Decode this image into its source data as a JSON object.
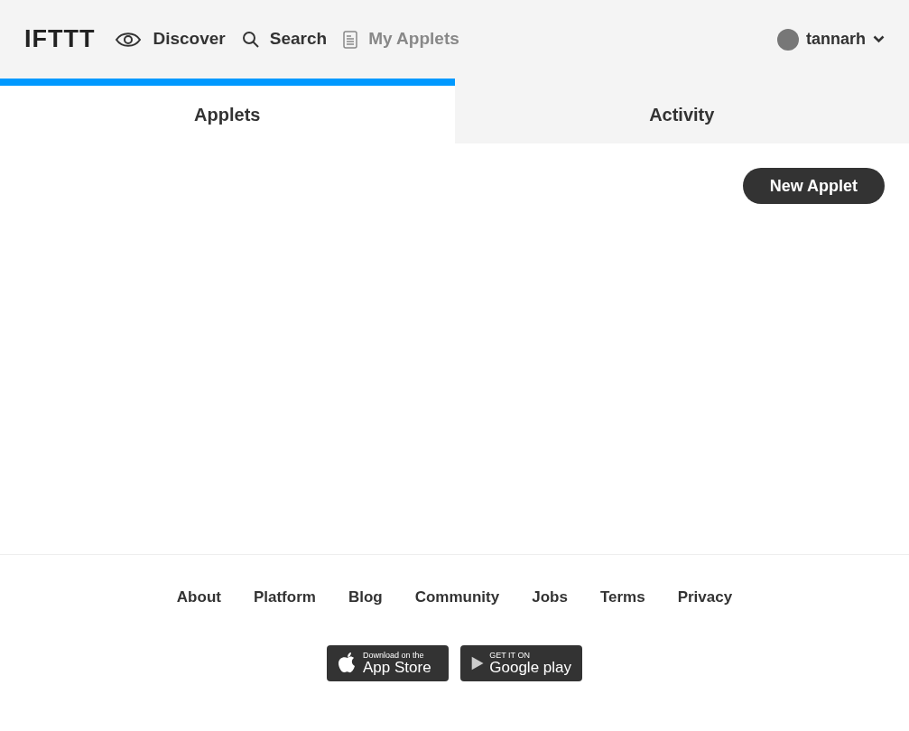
{
  "header": {
    "logo": "IFTTT",
    "nav": [
      {
        "kind": "eye",
        "label": "Discover",
        "selected": false
      },
      {
        "kind": "search",
        "label": "Search",
        "selected": false
      },
      {
        "kind": "doc",
        "label": "My Applets",
        "selected": true
      }
    ],
    "user": {
      "name": "tannarh"
    }
  },
  "tabs": [
    {
      "label": "Applets",
      "selected": true
    },
    {
      "label": "Activity",
      "selected": false
    }
  ],
  "new_applet_button": "New Applet",
  "footer": {
    "links": [
      "About",
      "Platform",
      "Blog",
      "Community",
      "Jobs",
      "Terms",
      "Privacy"
    ],
    "badges": [
      {
        "kind": "apple",
        "small": "Download on the",
        "large": "App Store"
      },
      {
        "kind": "google",
        "small": "GET IT ON",
        "large": "Google play"
      }
    ]
  }
}
